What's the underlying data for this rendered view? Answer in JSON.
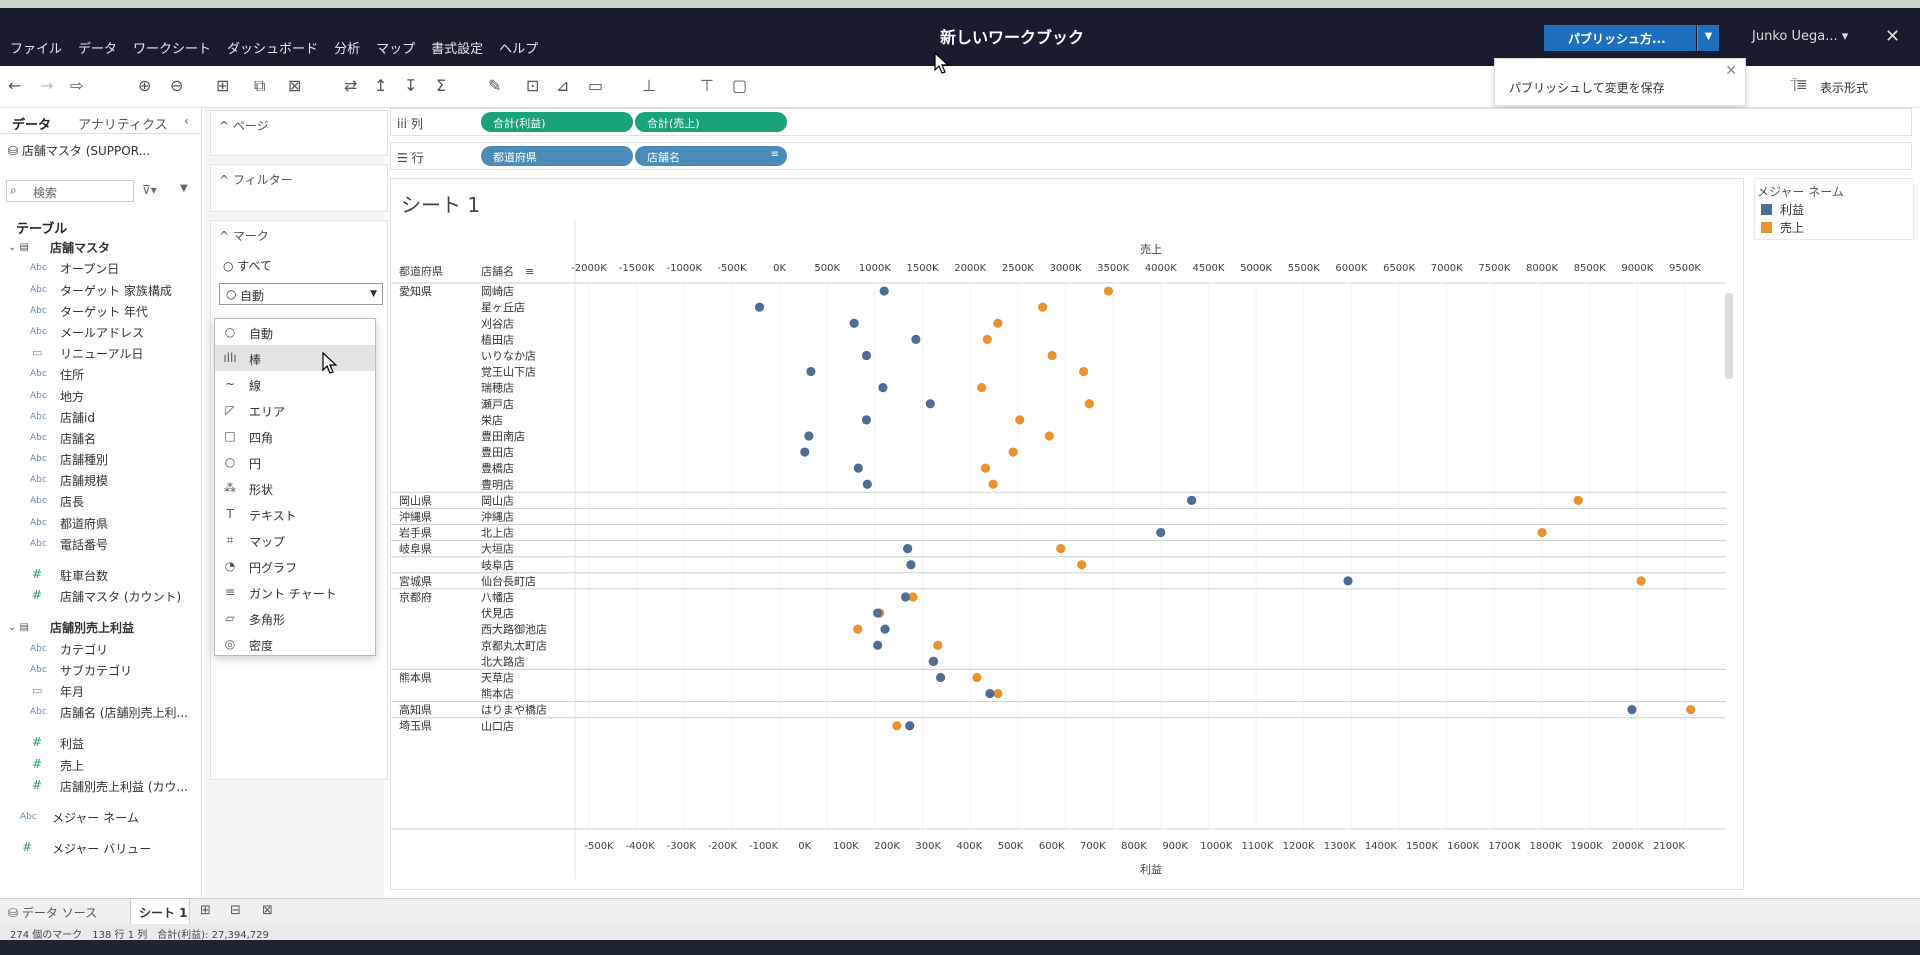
{
  "app": {
    "workbook_title": "新しいワークブック",
    "menu": [
      "ファイル",
      "データ",
      "ワークシート",
      "ダッシュボード",
      "分析",
      "マップ",
      "書式設定",
      "ヘルプ"
    ],
    "publish_label": "パブリッシュ方...",
    "user_name": "Junko Uega...",
    "tooltip": "パブリッシュして変更を保存",
    "show_me": "表示形式"
  },
  "data_pane": {
    "tab_data": "データ",
    "tab_analytics": "アナリティクス",
    "datasource": "店舗マスタ (SUPPOR...",
    "search_placeholder": "検索",
    "fields": [
      {
        "kind": "section",
        "label": "テーブル"
      },
      {
        "kind": "table",
        "label": "店舗マスタ"
      },
      {
        "kind": "abc",
        "label": "オープン日"
      },
      {
        "kind": "abc",
        "label": "ターゲット 家族構成"
      },
      {
        "kind": "abc",
        "label": "ターゲット 年代"
      },
      {
        "kind": "abc",
        "label": "メールアドレス"
      },
      {
        "kind": "date",
        "label": "リニューアル日"
      },
      {
        "kind": "abc",
        "label": "住所"
      },
      {
        "kind": "abc",
        "label": "地方"
      },
      {
        "kind": "abc",
        "label": "店舗id"
      },
      {
        "kind": "abc",
        "label": "店舗名"
      },
      {
        "kind": "abc",
        "label": "店舗種別"
      },
      {
        "kind": "abc",
        "label": "店舗規模"
      },
      {
        "kind": "abc",
        "label": "店長"
      },
      {
        "kind": "abc",
        "label": "都道府県"
      },
      {
        "kind": "abc",
        "label": "電話番号"
      },
      {
        "kind": "gap",
        "label": ""
      },
      {
        "kind": "num",
        "label": "駐車台数"
      },
      {
        "kind": "num",
        "label": "店舗マスタ (カウント)"
      },
      {
        "kind": "gap",
        "label": ""
      },
      {
        "kind": "table",
        "label": "店舗別売上利益"
      },
      {
        "kind": "abc",
        "label": "カテゴリ"
      },
      {
        "kind": "abc",
        "label": "サブカテゴリ"
      },
      {
        "kind": "date",
        "label": "年月"
      },
      {
        "kind": "abc",
        "label": "店舗名 (店舗別売上利..."
      },
      {
        "kind": "gap",
        "label": ""
      },
      {
        "kind": "num",
        "label": "利益"
      },
      {
        "kind": "num",
        "label": "売上"
      },
      {
        "kind": "num",
        "label": "店舗別売上利益 (カウ..."
      },
      {
        "kind": "gap",
        "label": ""
      },
      {
        "kind": "abc0",
        "label": "メジャー ネーム"
      },
      {
        "kind": "gap",
        "label": ""
      },
      {
        "kind": "num0",
        "label": "メジャー バリュー"
      }
    ]
  },
  "shelves": {
    "pages": "ページ",
    "filters": "フィルター",
    "marks": "マーク",
    "marks_all": "すべて",
    "marks_type": "自動",
    "mark_types": [
      {
        "icon": "○",
        "label": "自動"
      },
      {
        "icon": "ıllı",
        "label": "棒"
      },
      {
        "icon": "~",
        "label": "線"
      },
      {
        "icon": "◸",
        "label": "エリア"
      },
      {
        "icon": "□",
        "label": "四角"
      },
      {
        "icon": "○",
        "label": "円"
      },
      {
        "icon": "⁂",
        "label": "形状"
      },
      {
        "icon": "T",
        "label": "テキスト"
      },
      {
        "icon": "⌗",
        "label": "マップ"
      },
      {
        "icon": "◔",
        "label": "円グラフ"
      },
      {
        "icon": "≡",
        "label": "ガント チャート"
      },
      {
        "icon": "▱",
        "label": "多角形"
      },
      {
        "icon": "◎",
        "label": "密度"
      }
    ],
    "columns_label": "列",
    "rows_label": "行",
    "column_pills": [
      "合計(利益)",
      "合計(売上)"
    ],
    "row_pills": [
      "都道府県",
      "店舗名"
    ]
  },
  "view": {
    "sheet_title": "シート 1",
    "header_pref": "都道府県",
    "header_store": "店舗名"
  },
  "legend": {
    "title": "メジャー ネーム",
    "items": [
      {
        "name": "利益",
        "color": "#4e6c95"
      },
      {
        "name": "売上",
        "color": "#e8922e"
      }
    ]
  },
  "chart_data": {
    "type": "scatter",
    "top_axis": {
      "title": "売上",
      "min": -2000,
      "max": 9500,
      "step": 500,
      "unit": "K"
    },
    "bottom_axis": {
      "title": "利益",
      "min": -500,
      "max": 2100,
      "step": 100,
      "unit": "K"
    },
    "groups": [
      {
        "pref": "愛知県",
        "rows": [
          {
            "store": "岡崎店",
            "profit": 193,
            "sales": 3450
          },
          {
            "store": "星ヶ丘店",
            "profit": -110,
            "sales": 2760
          },
          {
            "store": "刈谷店",
            "profit": 120,
            "sales": 2290
          },
          {
            "store": "植田店",
            "profit": 270,
            "sales": 2180
          },
          {
            "store": "いりなか店",
            "profit": 150,
            "sales": 2860
          },
          {
            "store": "覚王山下店",
            "profit": 15,
            "sales": 3190
          },
          {
            "store": "瑞穂店",
            "profit": 190,
            "sales": 2120
          },
          {
            "store": "瀬戸店",
            "profit": 305,
            "sales": 3250
          },
          {
            "store": "栄店",
            "profit": 150,
            "sales": 2520
          },
          {
            "store": "豊田南店",
            "profit": 10,
            "sales": 2830
          },
          {
            "store": "豊田店",
            "profit": 0,
            "sales": 2450
          },
          {
            "store": "豊橋店",
            "profit": 130,
            "sales": 2160
          },
          {
            "store": "豊明店",
            "profit": 152,
            "sales": 2240
          }
        ]
      },
      {
        "pref": "岡山県",
        "rows": [
          {
            "store": "岡山店",
            "profit": 940,
            "sales": 8380
          }
        ]
      },
      {
        "pref": "沖縄県",
        "rows": [
          {
            "store": "沖縄店",
            "profit": null,
            "sales": null
          }
        ]
      },
      {
        "pref": "岩手県",
        "rows": [
          {
            "store": "北上店",
            "profit": 865,
            "sales": 8000
          }
        ]
      },
      {
        "pref": "岐阜県",
        "rows": [
          {
            "store": "大垣店",
            "profit": 250,
            "sales": 2950
          }
        ]
      },
      {
        "pref": "",
        "rows": [
          {
            "store": "岐阜店",
            "profit": 258,
            "sales": 3170
          }
        ]
      },
      {
        "pref": "宮城県",
        "rows": [
          {
            "store": "仙台長町店",
            "profit": 1320,
            "sales": 9040
          }
        ]
      },
      {
        "pref": "京都府",
        "rows": [
          {
            "store": "八幡店",
            "profit": 245,
            "sales": 1400
          },
          {
            "store": "伏見店",
            "profit": 177,
            "sales": 1050
          },
          {
            "store": "西大路御池店",
            "profit": 195,
            "sales": 820
          },
          {
            "store": "京都丸太町店",
            "profit": 177,
            "sales": 1660
          },
          {
            "store": "北大路店",
            "profit": 313,
            "sales": 1610
          }
        ]
      },
      {
        "pref": "熊本県",
        "rows": [
          {
            "store": "天草店",
            "profit": 330,
            "sales": 2070
          },
          {
            "store": "熊本店",
            "profit": 450,
            "sales": 2290
          }
        ]
      },
      {
        "pref": "高知県",
        "rows": [
          {
            "store": "はりまや橋店",
            "profit": 2010,
            "sales": 9560
          }
        ]
      },
      {
        "pref": "埼玉県",
        "rows": [
          {
            "store": "山口店",
            "profit": 255,
            "sales": 1230
          }
        ]
      }
    ]
  },
  "bottom": {
    "datasource_tab": "データ ソース",
    "sheet_tab": "シート 1",
    "status": "274 個のマーク　138 行 1 列　合計(利益): 27,394,729"
  }
}
